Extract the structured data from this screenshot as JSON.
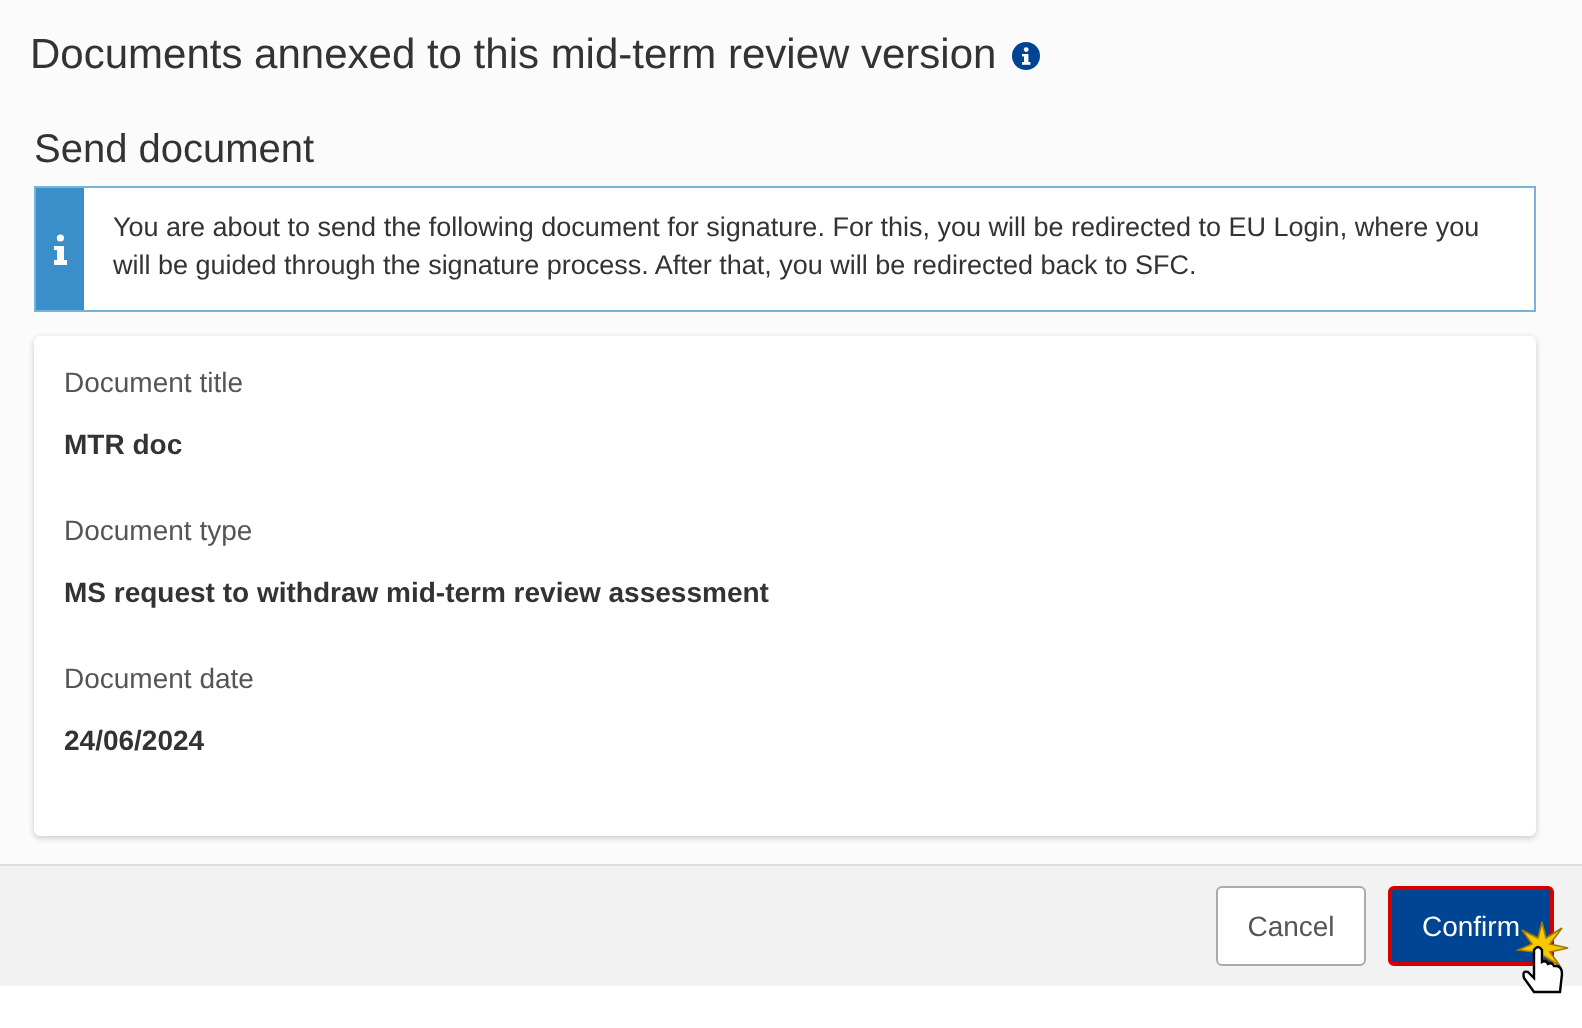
{
  "page_title": "Documents annexed to this mid-term review version",
  "dialog": {
    "title": "Send document",
    "info_message": "You are about to send the following document for signature. For this, you will be redirected to EU Login, where you will be guided through the signature process. After that, you will be redirected back to SFC.",
    "fields": [
      {
        "label": "Document title",
        "value": "MTR doc"
      },
      {
        "label": "Document type",
        "value": "MS request to withdraw mid-term review assessment"
      },
      {
        "label": "Document date",
        "value": "24/06/2024"
      }
    ],
    "buttons": [
      {
        "label": "Cancel",
        "kind": "secondary",
        "highlighted": false
      },
      {
        "label": "Confirm",
        "kind": "primary",
        "highlighted": true
      }
    ]
  }
}
